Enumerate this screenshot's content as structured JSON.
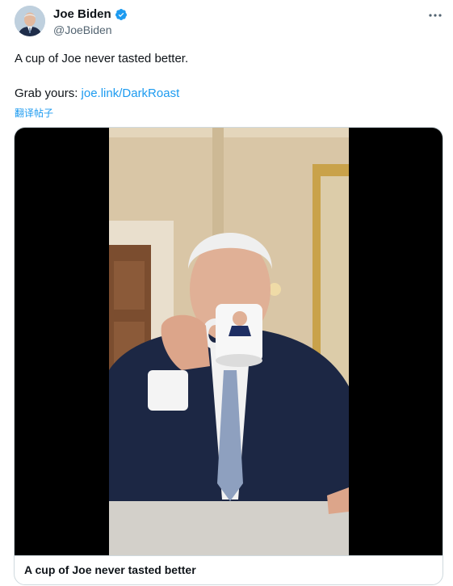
{
  "user": {
    "name": "Joe Biden",
    "handle": "@JoeBiden",
    "verified": true
  },
  "tweet": {
    "line1": "A cup of Joe never tasted better.",
    "line2_prefix": "Grab yours: ",
    "link_text": "joe.link/DarkRoast",
    "translate_label": "翻译帖子"
  },
  "media": {
    "caption": "A cup of Joe never tasted better"
  },
  "colors": {
    "link": "#1d9bf0",
    "verified": "#1d9bf0",
    "muted": "#536471"
  }
}
